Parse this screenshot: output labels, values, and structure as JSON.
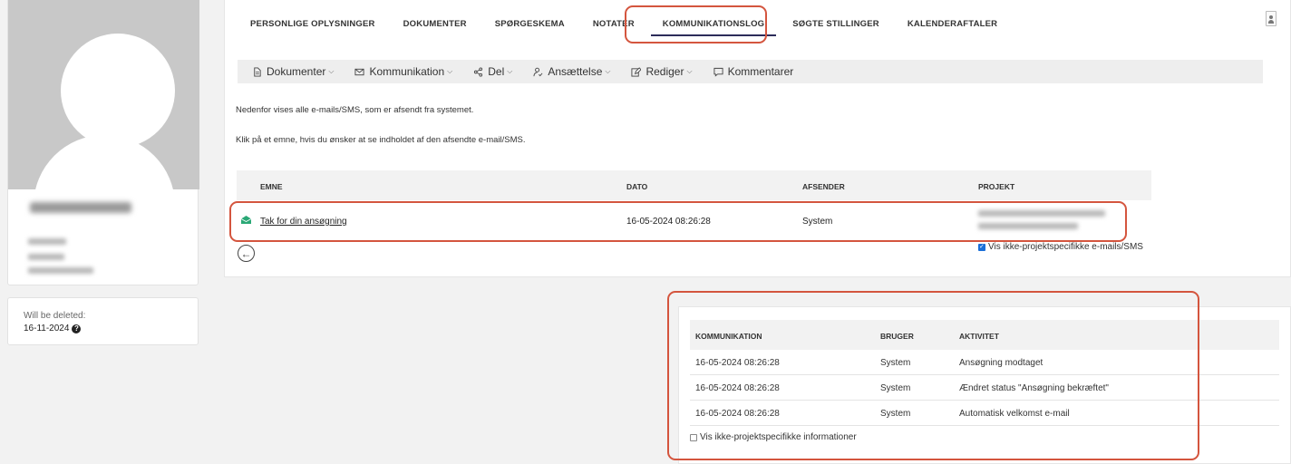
{
  "tabs": [
    {
      "label": "PERSONLIGE OPLYSNINGER"
    },
    {
      "label": "DOKUMENTER"
    },
    {
      "label": "SPØRGESKEMA"
    },
    {
      "label": "NOTATER"
    },
    {
      "label": "KOMMUNIKATIONSLOG",
      "active": true
    },
    {
      "label": "SØGTE STILLINGER"
    },
    {
      "label": "KALENDERAFTALER"
    }
  ],
  "toolbar": {
    "dokumenter": "Dokumenter",
    "kommunikation": "Kommunikation",
    "del": "Del",
    "ansaettelse": "Ansættelse",
    "rediger": "Rediger",
    "kommentarer": "Kommentarer"
  },
  "intro": {
    "line1": "Nedenfor vises alle e-mails/SMS, som er afsendt fra systemet.",
    "line2": "Klik på et emne, hvis du ønsker at se indholdet af den afsendte e-mail/SMS."
  },
  "log_table": {
    "headers": {
      "emne": "EMNE",
      "dato": "DATO",
      "afsender": "AFSENDER",
      "projekt": "PROJEKT"
    },
    "rows": [
      {
        "emne": "Tak for din ansøgning",
        "dato": "16-05-2024 08:26:28",
        "afsender": "System"
      }
    ]
  },
  "vis_ikke_projekt_mails": {
    "label": "Vis ikke-projektspecifikke e-mails/SMS",
    "checked": true
  },
  "profile": {
    "delete_label": "Will be deleted:",
    "delete_date": "16-11-2024"
  },
  "activity_table": {
    "headers": {
      "kommunikation": "KOMMUNIKATION",
      "bruger": "BRUGER",
      "aktivitet": "AKTIVITET"
    },
    "rows": [
      {
        "kommunikation": "16-05-2024 08:26:28",
        "bruger": "System",
        "aktivitet": "Ansøgning modtaget"
      },
      {
        "kommunikation": "16-05-2024 08:26:28",
        "bruger": "System",
        "aktivitet": "Ændret status \"Ansøgning bekræftet\""
      },
      {
        "kommunikation": "16-05-2024 08:26:28",
        "bruger": "System",
        "aktivitet": "Automatisk velkomst e-mail"
      }
    ]
  },
  "vis_ikke_projekt_info": {
    "label": "Vis ikke-projektspecifikke informationer",
    "checked": false
  },
  "colors": {
    "highlight": "#d4553e",
    "active_tab_underline": "#2c2c5a",
    "checkbox": "#1a6fd8",
    "mail_icon": "#2aa876"
  }
}
